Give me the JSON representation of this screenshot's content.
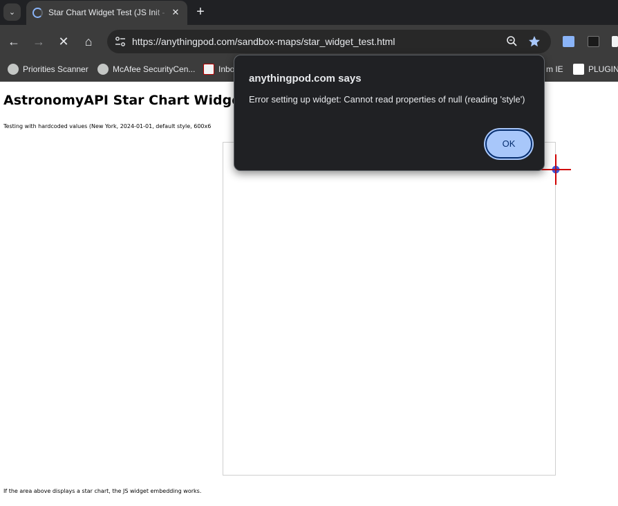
{
  "browser": {
    "tab": {
      "title": "Star Chart Widget Test (JS Init - ",
      "close": "✕"
    },
    "new_tab": "+",
    "tab_search": "⌄",
    "nav": {
      "back": "←",
      "forward": "→",
      "stop": "✕",
      "home": "⌂"
    },
    "omnibox": {
      "url": "https://anythingpod.com/sandbox-maps/star_widget_test.html",
      "site_info_icon": "tune-icon",
      "zoom_icon": "magnifier-icon",
      "bookmark_icon": "star-filled-icon"
    },
    "bookmarks": [
      {
        "label": "Priorities Scanner",
        "icon": "globe-icon"
      },
      {
        "label": "McAfee SecurityCen...",
        "icon": "globe-icon"
      },
      {
        "label": "Inbo",
        "icon": "100-icon"
      },
      {
        "label": "m IE",
        "icon": "globe-icon"
      },
      {
        "label": "PLUGINS",
        "icon": "plugins-icon"
      }
    ]
  },
  "page": {
    "title": "AstronomyAPI Star Chart Widget Tes",
    "description": "Testing with hardcoded values (New York, 2024-01-01, default style, 600x6",
    "footer": "If the area above displays a star chart, the JS widget embedding works."
  },
  "dialog": {
    "title": "anythingpod.com says",
    "message": "Error setting up widget: Cannot read properties of null (reading 'style')",
    "ok_label": "OK"
  },
  "colors": {
    "accent": "#a8c7fa",
    "chrome_bg": "#202124",
    "toolbar_bg": "#3c3c3c",
    "crosshair_red": "#d00000",
    "crosshair_blue": "#1a3fd6"
  }
}
